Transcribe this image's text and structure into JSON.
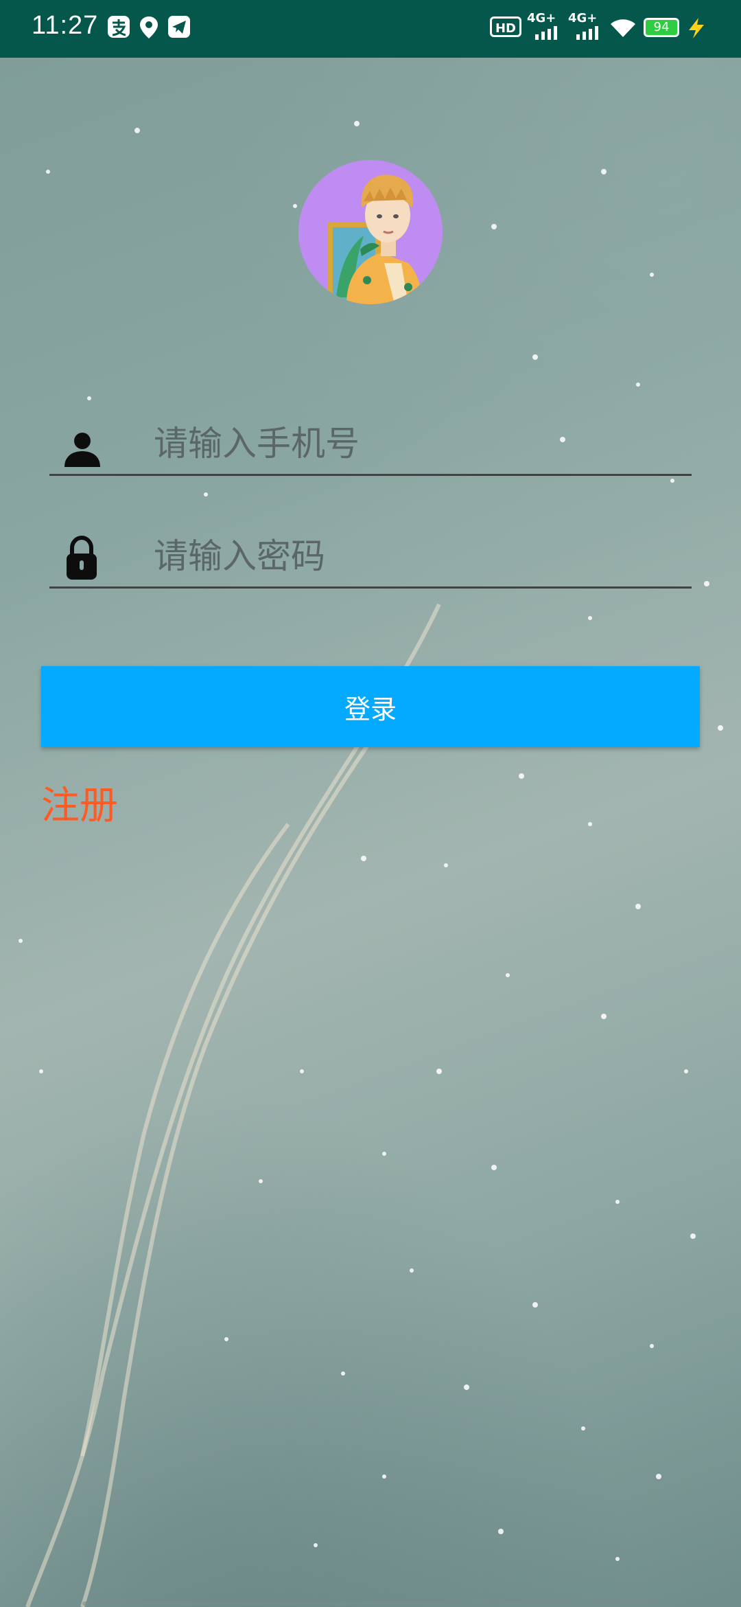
{
  "status_bar": {
    "time": "11:27",
    "network_1": "4G+",
    "network_2": "4G+",
    "battery_level": "94",
    "hd_label": "HD"
  },
  "login_form": {
    "phone_placeholder": "请输入手机号",
    "password_placeholder": "请输入密码",
    "login_label": "登录",
    "register_label": "注册"
  },
  "colors": {
    "status_bar": "#04574a",
    "login_button": "#03aaff",
    "register_link": "#ff5a24",
    "avatar_bg": "#bf8cf1"
  }
}
